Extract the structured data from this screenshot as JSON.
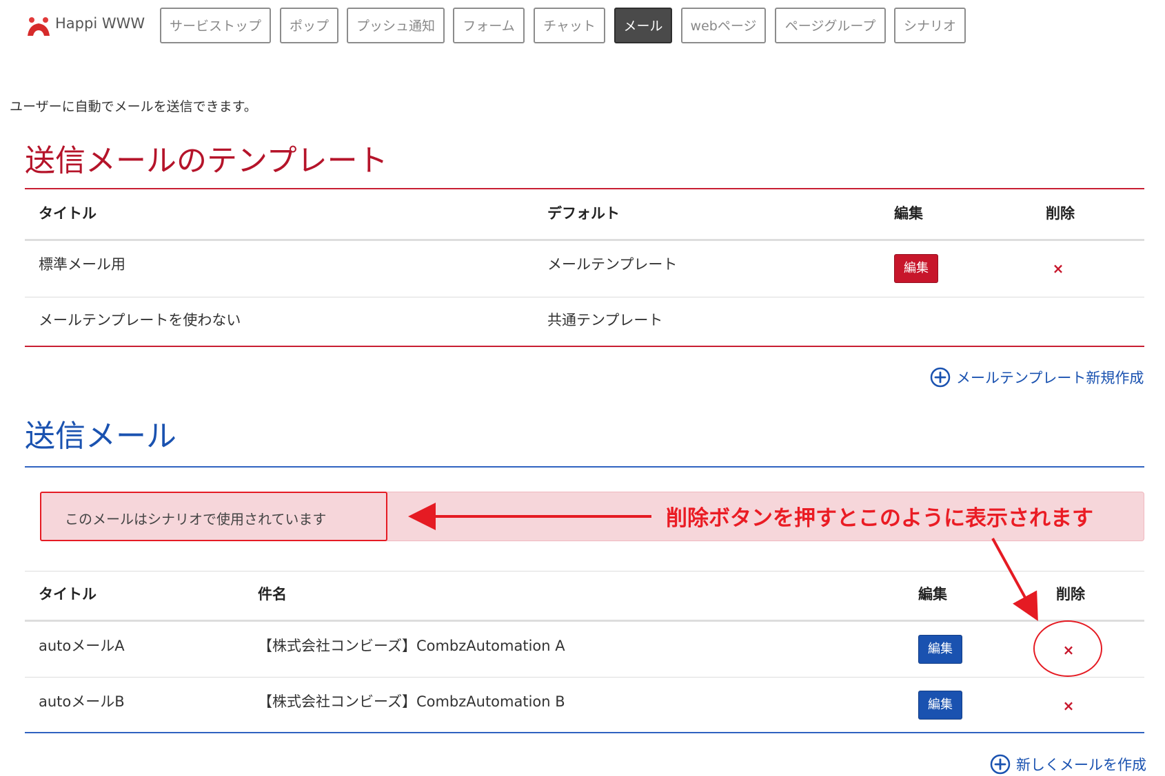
{
  "nav": {
    "brand": "Happi WWW",
    "tabs": [
      {
        "label": "サービストップ"
      },
      {
        "label": "ポップ"
      },
      {
        "label": "プッシュ通知"
      },
      {
        "label": "フォーム"
      },
      {
        "label": "チャット"
      },
      {
        "label": "メール",
        "active": true
      },
      {
        "label": "webページ"
      },
      {
        "label": "ページグループ"
      },
      {
        "label": "シナリオ"
      }
    ]
  },
  "intro": "ユーザーに自動でメールを送信できます。",
  "templates": {
    "heading": "送信メールのテンプレート",
    "columns": {
      "title": "タイトル",
      "default": "デフォルト",
      "edit": "編集",
      "delete": "削除"
    },
    "rows": [
      {
        "title": "標準メール用",
        "default": "メールテンプレート",
        "edit_label": "編集",
        "delete_icon": "×"
      },
      {
        "title": "メールテンプレートを使わない",
        "default": "共通テンプレート"
      }
    ],
    "add_link": "メールテンプレート新規作成"
  },
  "mails": {
    "heading": "送信メール",
    "alert": "このメールはシナリオで使用されています",
    "columns": {
      "title": "タイトル",
      "subject": "件名",
      "edit": "編集",
      "delete": "削除"
    },
    "rows": [
      {
        "title": "autoメールA",
        "subject": "【株式会社コンビーズ】CombzAutomation A",
        "edit_label": "編集",
        "delete_icon": "×"
      },
      {
        "title": "autoメールB",
        "subject": "【株式会社コンビーズ】CombzAutomation B",
        "edit_label": "編集",
        "delete_icon": "×"
      }
    ],
    "add_link": "新しくメールを作成"
  },
  "annotation": {
    "text": "削除ボタンを押すとこのように表示されます"
  },
  "colors": {
    "accent_red": "#c7162b",
    "accent_blue": "#1a52b0",
    "annotation_red": "#e51b23",
    "alert_bg": "#f6d6da"
  }
}
